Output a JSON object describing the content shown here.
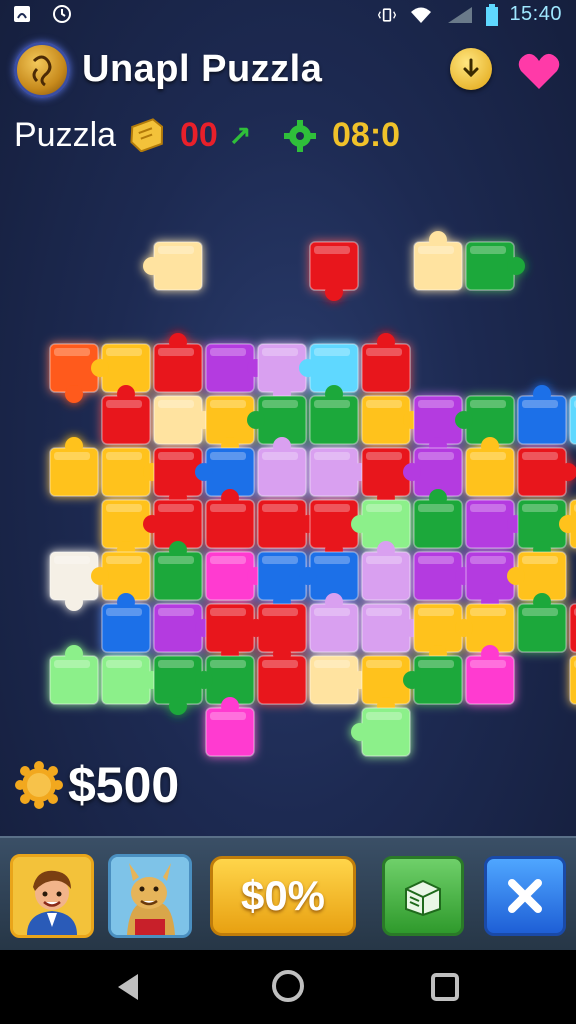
{
  "status_bar": {
    "time": "15:40",
    "icons": [
      "sim-icon",
      "alarm-icon",
      "vibrate-icon",
      "wifi-icon",
      "signal-icon",
      "battery-icon"
    ]
  },
  "header": {
    "title": "Unapl Puzzla",
    "logo_icon": "coin-emblem-icon",
    "download_icon": "download-icon",
    "favorite_icon": "heart-icon"
  },
  "stats": {
    "label": "Puzzla",
    "score": "00",
    "score_trend": "↗",
    "timer": "08:0"
  },
  "coins": {
    "value": "$500"
  },
  "tray": {
    "offer_label": "$0%",
    "store_icon": "gift-box-icon",
    "close_icon": "close-icon"
  },
  "colors": {
    "red": "#e8161e",
    "orange": "#ff5a1a",
    "yellow": "#ffc21a",
    "cream": "#ffe3a0",
    "green": "#1fa83a",
    "lightgreen": "#8cf08a",
    "blue": "#1e6fe8",
    "cyan": "#5fd8ff",
    "purple": "#b43ae0",
    "lavender": "#d9a0f0",
    "pink": "#ff3ad0",
    "white": "#f5f0e6"
  }
}
